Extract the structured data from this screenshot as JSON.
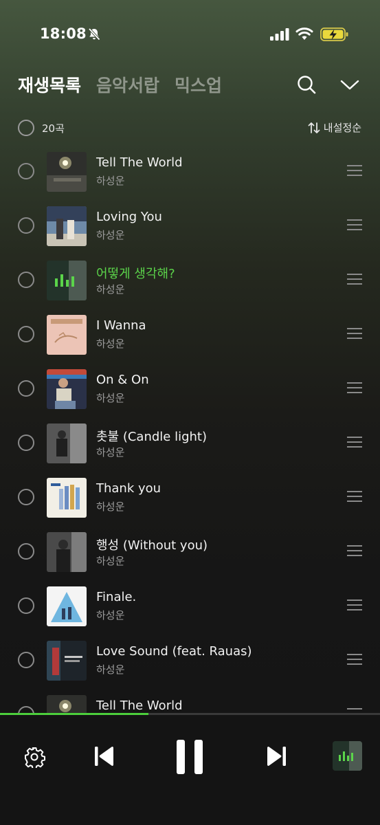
{
  "status": {
    "time": "18:08"
  },
  "tabs": [
    {
      "label": "재생목록",
      "active": true
    },
    {
      "label": "음악서랍",
      "active": false
    },
    {
      "label": "믹스업",
      "active": false
    }
  ],
  "list_header": {
    "count": "20곡",
    "sort": "내설정순"
  },
  "songs": [
    {
      "title": "Tell The World",
      "artist": "하성운"
    },
    {
      "title": "Loving You",
      "artist": "하성운"
    },
    {
      "title": "어떻게 생각해?",
      "artist": "하성운",
      "playing": true
    },
    {
      "title": "I Wanna",
      "artist": "하성운"
    },
    {
      "title": "On & On",
      "artist": "하성운"
    },
    {
      "title": "촛불 (Candle light)",
      "artist": "하성운"
    },
    {
      "title": "Thank you",
      "artist": "하성운"
    },
    {
      "title": "행성 (Without you)",
      "artist": "하성운"
    },
    {
      "title": "Finale.",
      "artist": "하성운"
    },
    {
      "title": "Love Sound (feat. Rauas)",
      "artist": "하성운"
    },
    {
      "title": "Tell The World",
      "artist": ""
    }
  ],
  "player": {
    "progress": 0.39
  },
  "colors": {
    "accent": "#5bd44a",
    "progress": "#4ccf3c"
  },
  "icons": [
    "bell-slash-icon",
    "signal-icon",
    "wifi-icon",
    "battery-charging-icon",
    "search-icon",
    "chevron-down-icon",
    "sort-icon",
    "drag-handle-icon",
    "gear-icon",
    "previous-icon",
    "pause-icon",
    "next-icon"
  ]
}
